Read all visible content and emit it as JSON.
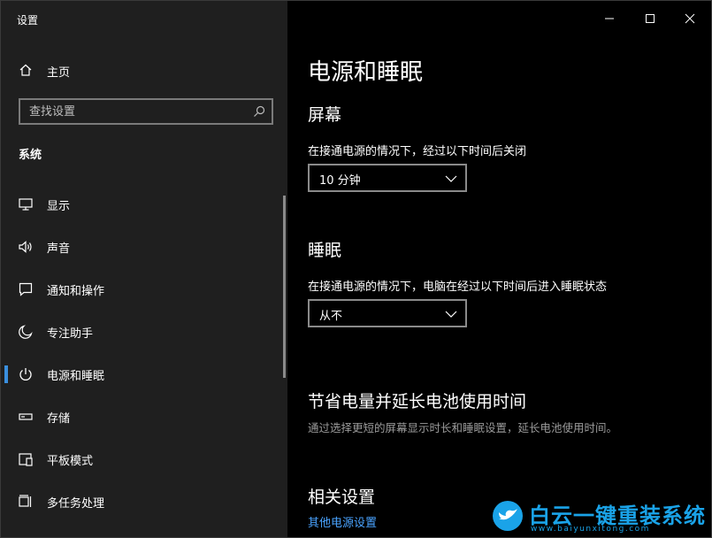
{
  "window": {
    "title": "设置"
  },
  "sidebar": {
    "home_label": "主页",
    "search_placeholder": "查找设置",
    "section_label": "系统",
    "items": [
      {
        "label": "显示",
        "icon": "monitor-icon"
      },
      {
        "label": "声音",
        "icon": "speaker-icon"
      },
      {
        "label": "通知和操作",
        "icon": "notification-icon"
      },
      {
        "label": "专注助手",
        "icon": "moon-icon"
      },
      {
        "label": "电源和睡眠",
        "icon": "power-icon",
        "active": true
      },
      {
        "label": "存储",
        "icon": "storage-icon"
      },
      {
        "label": "平板模式",
        "icon": "tablet-icon"
      },
      {
        "label": "多任务处理",
        "icon": "multitask-icon"
      }
    ]
  },
  "main": {
    "title": "电源和睡眠",
    "screen": {
      "heading": "屏幕",
      "description": "在接通电源的情况下，经过以下时间后关闭",
      "selected": "10 分钟"
    },
    "sleep": {
      "heading": "睡眠",
      "description": "在接通电源的情况下，电脑在经过以下时间后进入睡眠状态",
      "selected": "从不"
    },
    "battery": {
      "heading": "节省电量并延长电池使用时间",
      "description": "通过选择更短的屏幕显示时长和睡眠设置，延长电池使用时间。"
    },
    "related": {
      "heading": "相关设置",
      "link": "其他电源设置"
    }
  },
  "watermark": {
    "text": "白云一键重装系统",
    "url": "www.baiyunxitong.com"
  },
  "colors": {
    "accent": "#3a8fde",
    "link": "#4aa3ff",
    "sidebar_bg": "#1f1f1f",
    "main_bg": "#000000"
  }
}
